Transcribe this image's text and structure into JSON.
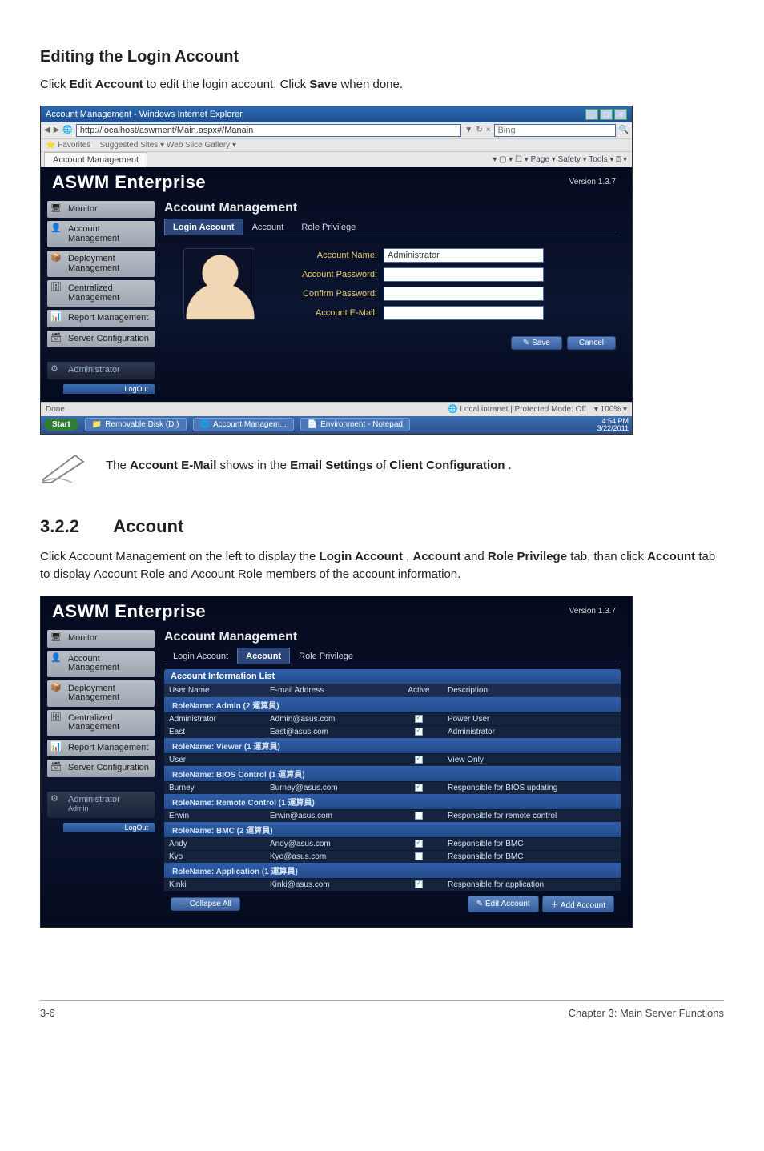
{
  "section1": {
    "heading": "Editing the Login Account",
    "body_pre": "Click ",
    "body_bold1": "Edit Account",
    "body_mid": " to edit the login account. Click ",
    "body_bold2": "Save",
    "body_post": " when done."
  },
  "window1": {
    "titlebar": "Account Management - Windows Internet Explorer",
    "address": "http://localhost/aswment/Main.aspx#/Manain",
    "favorites_left": "Favorites",
    "favorites_items": "Suggested Sites ▾   Web Slice Gallery ▾",
    "tab": "Account Management",
    "toolbar_right": "▾ ▢ ▾  ☐  ▾ Page ▾  Safety ▾  Tools ▾  ⍰ ▾",
    "status_left": "Done",
    "status_mid": "Local intranet | Protected Mode: Off",
    "status_right": "▾ 100% ▾"
  },
  "aswm": {
    "title": "ASWM Enterprise",
    "version": "Version 1.3.7",
    "sidebar": {
      "monitor": "Monitor",
      "account": "Account Management",
      "deployment": "Deployment Management",
      "centralized": "Centralized Management",
      "report": "Report Management",
      "server": "Server Configuration",
      "admin": "Administrator",
      "admin_user": "Admin",
      "logout": "LogOut"
    },
    "content_heading": "Account Management",
    "tabs": {
      "login": "Login Account",
      "account": "Account",
      "role": "Role Privilege"
    },
    "form": {
      "name_label": "Account Name:",
      "name_value": "Administrator",
      "password_label": "Account Password:",
      "confirm_label": "Confirm Password:",
      "email_label": "Account E-Mail:"
    },
    "buttons": {
      "save": "Save",
      "cancel": "Cancel"
    }
  },
  "taskbar": {
    "start": "Start",
    "item1": "Removable Disk (D:)",
    "item2": "Account Managem...",
    "item3": "Environment - Notepad",
    "clock1": "4:54 PM",
    "clock2": "3/22/2011"
  },
  "note": {
    "pre": "The ",
    "bold1": "Account E-Mail",
    "mid1": " shows in the ",
    "bold2": "Email Settings",
    "mid2": " of ",
    "bold3": "Client Configuration",
    "post": "."
  },
  "section2": {
    "num": "3.2.2",
    "title": "Account",
    "body": {
      "p1a": "Click Account Management on the left to display the ",
      "b1": "Login Account",
      "sep1": ", ",
      "b2": "Account",
      "p1b": " and ",
      "b3": "Role Privilege",
      "p1c": " tab, than click ",
      "b4": "Account",
      "p1d": " tab to display Account Role and Account Role members of the account information."
    }
  },
  "acct_list": {
    "info_header": "Account Information List",
    "head": {
      "c1": "User Name",
      "c2": "E-mail Address",
      "c3": "Active",
      "c4": "Description"
    },
    "groups": [
      {
        "label": "RoleName: Admin (2 運算員)",
        "rows": [
          {
            "c1": "Administrator",
            "c2": "Admin@asus.com",
            "c3": true,
            "c4": "Power User"
          },
          {
            "c1": "East",
            "c2": "East@asus.com",
            "c3": true,
            "c4": "Administrator"
          }
        ]
      },
      {
        "label": "RoleName: Viewer (1 運算員)",
        "rows": [
          {
            "c1": "User",
            "c2": "",
            "c3": true,
            "c4": "View Only"
          }
        ]
      },
      {
        "label": "RoleName: BIOS Control (1 運算員)",
        "rows": [
          {
            "c1": "Burney",
            "c2": "Burney@asus.com",
            "c3": true,
            "c4": "Responsible for BIOS updating"
          }
        ]
      },
      {
        "label": "RoleName: Remote Control (1 運算員)",
        "rows": [
          {
            "c1": "Erwin",
            "c2": "Erwin@asus.com",
            "c3": false,
            "c4": "Responsible for remote control"
          }
        ]
      },
      {
        "label": "RoleName: BMC (2 運算員)",
        "rows": [
          {
            "c1": "Andy",
            "c2": "Andy@asus.com",
            "c3": true,
            "c4": "Responsible for BMC"
          },
          {
            "c1": "Kyo",
            "c2": "Kyo@asus.com",
            "c3": false,
            "c4": "Responsible for BMC"
          }
        ]
      },
      {
        "label": "RoleName: Application (1 運算員)",
        "rows": [
          {
            "c1": "Kinki",
            "c2": "Kinki@asus.com",
            "c3": true,
            "c4": "Responsible for application"
          }
        ]
      }
    ],
    "collapse": "Collapse All",
    "edit_account": "Edit Account",
    "add_account": "Add Account"
  },
  "footer": {
    "left": "3-6",
    "right": "Chapter 3: Main Server Functions"
  }
}
